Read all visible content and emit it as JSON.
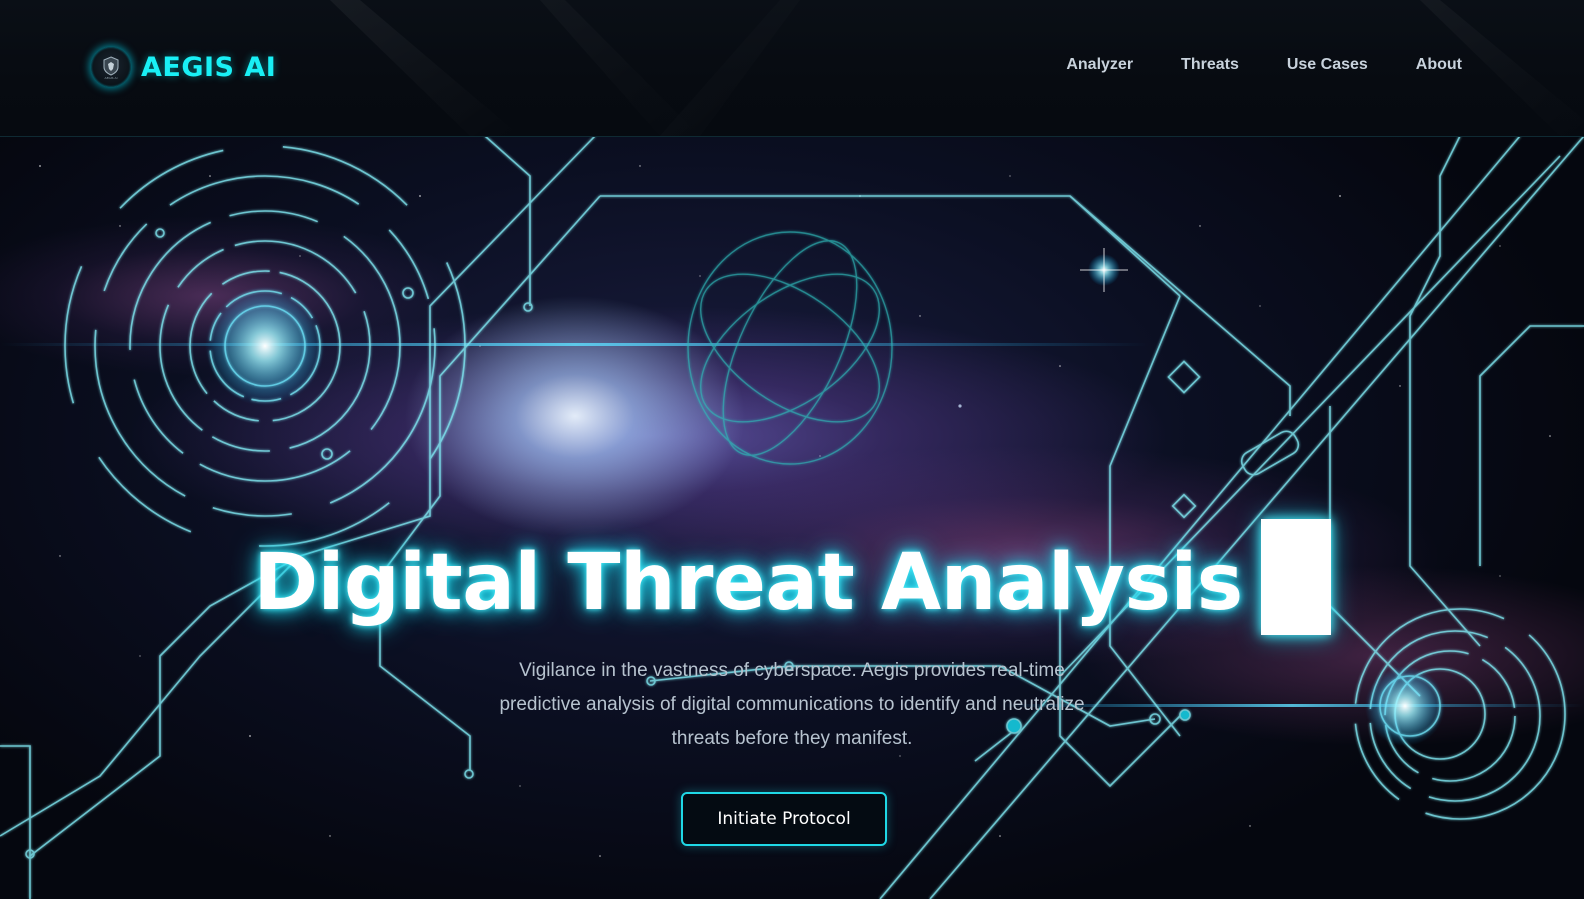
{
  "brand": {
    "name": "AEGIS AI",
    "logo_icon": "shield-head-icon",
    "logo_caption": "AEGIS AI"
  },
  "nav": {
    "links": [
      {
        "label": "Analyzer"
      },
      {
        "label": "Threats"
      },
      {
        "label": "Use Cases"
      },
      {
        "label": "About"
      }
    ]
  },
  "hero": {
    "title": "Digital Threat Analysis",
    "subtitle": "Vigilance in the vastness of cyberspace. Aegis provides real-time predictive analysis of digital communications to identify and neutralize threats before they manifest.",
    "cta_label": "Initiate Protocol",
    "background": "galaxy-circuit-illustration"
  },
  "colors": {
    "accent": "#19f0f5",
    "nav_text": "#c8d2dc",
    "subtitle_text": "#b7c3cf",
    "background": "#05080d"
  }
}
